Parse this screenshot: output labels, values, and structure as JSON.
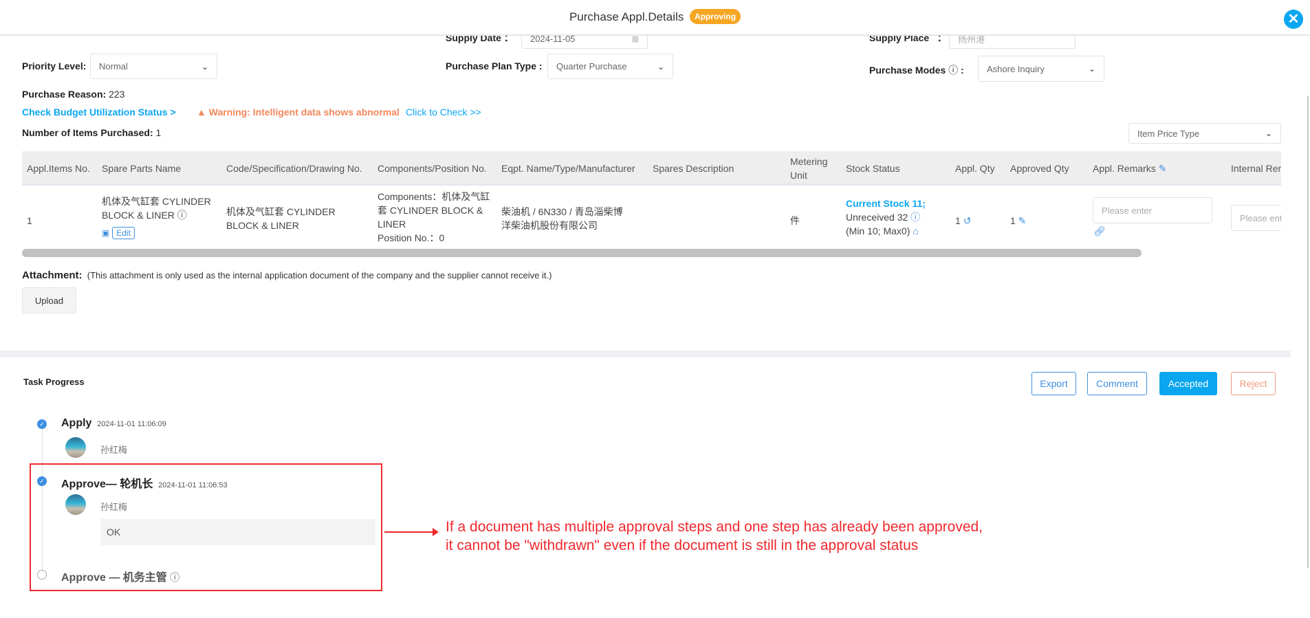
{
  "header": {
    "title": "Purchase Appl.Details",
    "status_badge": "Approving",
    "close_icon": "close-icon"
  },
  "form": {
    "supply_date_label": "Supply Date",
    "supply_date_sep": "：",
    "supply_date_value": "2024-11-05",
    "supply_place_label": "Supply Place",
    "supply_place_sep": "：",
    "supply_place_value": "扬州港",
    "priority_label": "Priority Level:",
    "priority_value": "Normal",
    "plan_type_label": "Purchase Plan Type :",
    "plan_type_value": "Quarter Purchase",
    "modes_label": "Purchase Modes",
    "modes_sep": ":",
    "modes_value": "Ashore Inquiry",
    "reason_label": "Purchase Reason:",
    "reason_value": "223",
    "budget_link": "Check Budget Utilization Status >",
    "warning": "Warning: Intelligent data shows abnormal",
    "check_link": "Click to Check >>",
    "items_label": "Number of Items Purchased:",
    "items_value": "1",
    "price_type_value": "Item Price Type"
  },
  "table": {
    "headers": [
      "Appl.Items No.",
      "Spare Parts Name",
      "Code/Specification/Drawing No.",
      "Components/Position No.",
      "Eqpt. Name/Type/Manufacturer",
      "Spares Description",
      "Metering Unit",
      "Stock Status",
      "Appl. Qty",
      "Approved Qty",
      "Appl. Remarks",
      "Internal Rem"
    ],
    "row": {
      "no": "1",
      "spare_name": "机体及气缸套 CYLINDER BLOCK & LINER",
      "edit": "Edit",
      "code": "机体及气缸套 CYLINDER BLOCK & LINER",
      "components": "Components：机体及气缸套 CYLINDER BLOCK & LINER",
      "position": "Position No.：0",
      "eqpt": "柴油机 / 6N330 / 青岛淄柴博洋柴油机股份有限公司",
      "unit": "件",
      "stock_current": "Current Stock 11;",
      "stock_unreceived": " Unreceived 32",
      "stock_minmax": "(Min 10; Max0)",
      "appl_qty": "1",
      "approved_qty": "1",
      "remarks_placeholder": "Please enter",
      "internal_placeholder": "Please enter"
    }
  },
  "attachment": {
    "label": "Attachment:",
    "note": "(This attachment is only used as the internal application document of the company and the supplier cannot receive it.)",
    "upload": "Upload"
  },
  "task": {
    "title": "Task Progress",
    "buttons": {
      "export": "Export",
      "comment": "Comment",
      "accepted": "Accepted",
      "reject": "Reject"
    },
    "steps": [
      {
        "title": "Apply",
        "time": "2024-11-01 11:06:09",
        "user": "孙红梅",
        "done": true
      },
      {
        "title": "Approve— 轮机长",
        "time": "2024-11-01 11:06:53",
        "user": "孙红梅",
        "comment": "OK",
        "done": true
      },
      {
        "title": "Approve — 机务主管",
        "done": false
      }
    ]
  },
  "annotation": {
    "line1": "If a document has multiple approval steps and one step has already been approved,",
    "line2": "it cannot be \"withdrawn\" even if the document is still in the approval status"
  },
  "colors": {
    "accent": "#0aa6ef",
    "badge": "#f5a623",
    "warning": "#f0885c",
    "annotation": "#f0282d",
    "reject": "#f49a7e"
  }
}
